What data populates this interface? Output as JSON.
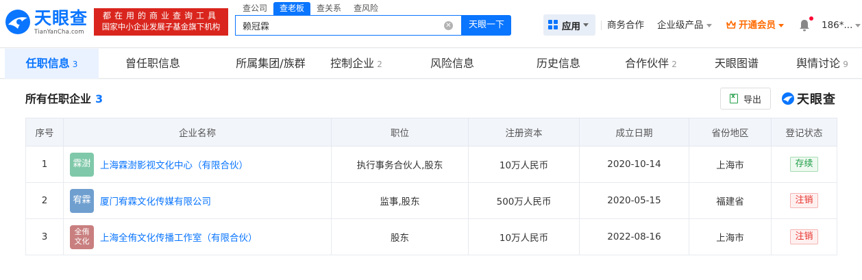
{
  "brand": {
    "name_cn": "天眼查",
    "name_en": "TianYanCha.com",
    "slogan_line1": "都在用的商业查询工具",
    "slogan_line2": "国家中小企业发展子基金旗下机构"
  },
  "search": {
    "tabs": [
      {
        "label": "查公司",
        "active": false
      },
      {
        "label": "查老板",
        "active": true
      },
      {
        "label": "查关系",
        "active": false
      },
      {
        "label": "查风险",
        "active": false
      }
    ],
    "value": "赖冠霖",
    "button_label": "天眼一下"
  },
  "nav": {
    "apps_label": "应用",
    "business": "商务合作",
    "enterprise": "企业级产品",
    "vip": "开通会员",
    "user": "186*..."
  },
  "tabs": [
    {
      "label": "任职信息",
      "count": "3",
      "active": true
    },
    {
      "label": "曾任职信息",
      "count": "",
      "active": false
    },
    {
      "label": "所属集团/族群",
      "count": "",
      "active": false
    },
    {
      "label": "控制企业",
      "count": "2",
      "active": false
    },
    {
      "label": "风险信息",
      "count": "",
      "active": false
    },
    {
      "label": "历史信息",
      "count": "",
      "active": false
    },
    {
      "label": "合作伙伴",
      "count": "2",
      "active": false
    },
    {
      "label": "天眼图谱",
      "count": "",
      "active": false
    },
    {
      "label": "舆情讨论",
      "count": "9",
      "active": false
    }
  ],
  "section": {
    "title": "所有任职企业",
    "count": "3",
    "export_label": "导出",
    "watermark": "天眼查"
  },
  "table": {
    "headers": [
      "序号",
      "企业名称",
      "职位",
      "注册资本",
      "成立日期",
      "省份地区",
      "登记状态"
    ],
    "rows": [
      {
        "no": "1",
        "logo_text": "霖澍",
        "logo_color": "#7fc8a9",
        "name": "上海霖澍影视文化中心（有限合伙）",
        "position": "执行事务合伙人,股东",
        "capital": "10万人民币",
        "date": "2020-10-14",
        "region": "上海市",
        "status": "存续",
        "status_type": "ok"
      },
      {
        "no": "2",
        "logo_text": "宥霖",
        "logo_color": "#6f9fcf",
        "name": "厦门宥霖文化传媒有限公司",
        "position": "监事,股东",
        "capital": "500万人民币",
        "date": "2020-05-15",
        "region": "福建省",
        "status": "注销",
        "status_type": "bad"
      },
      {
        "no": "3",
        "logo_text": "全侑文化",
        "logo_color": "#c97f7f",
        "name": "上海全侑文化传播工作室（有限合伙）",
        "position": "股东",
        "capital": "10万人民币",
        "date": "2022-08-16",
        "region": "上海市",
        "status": "注销",
        "status_type": "bad"
      }
    ]
  }
}
